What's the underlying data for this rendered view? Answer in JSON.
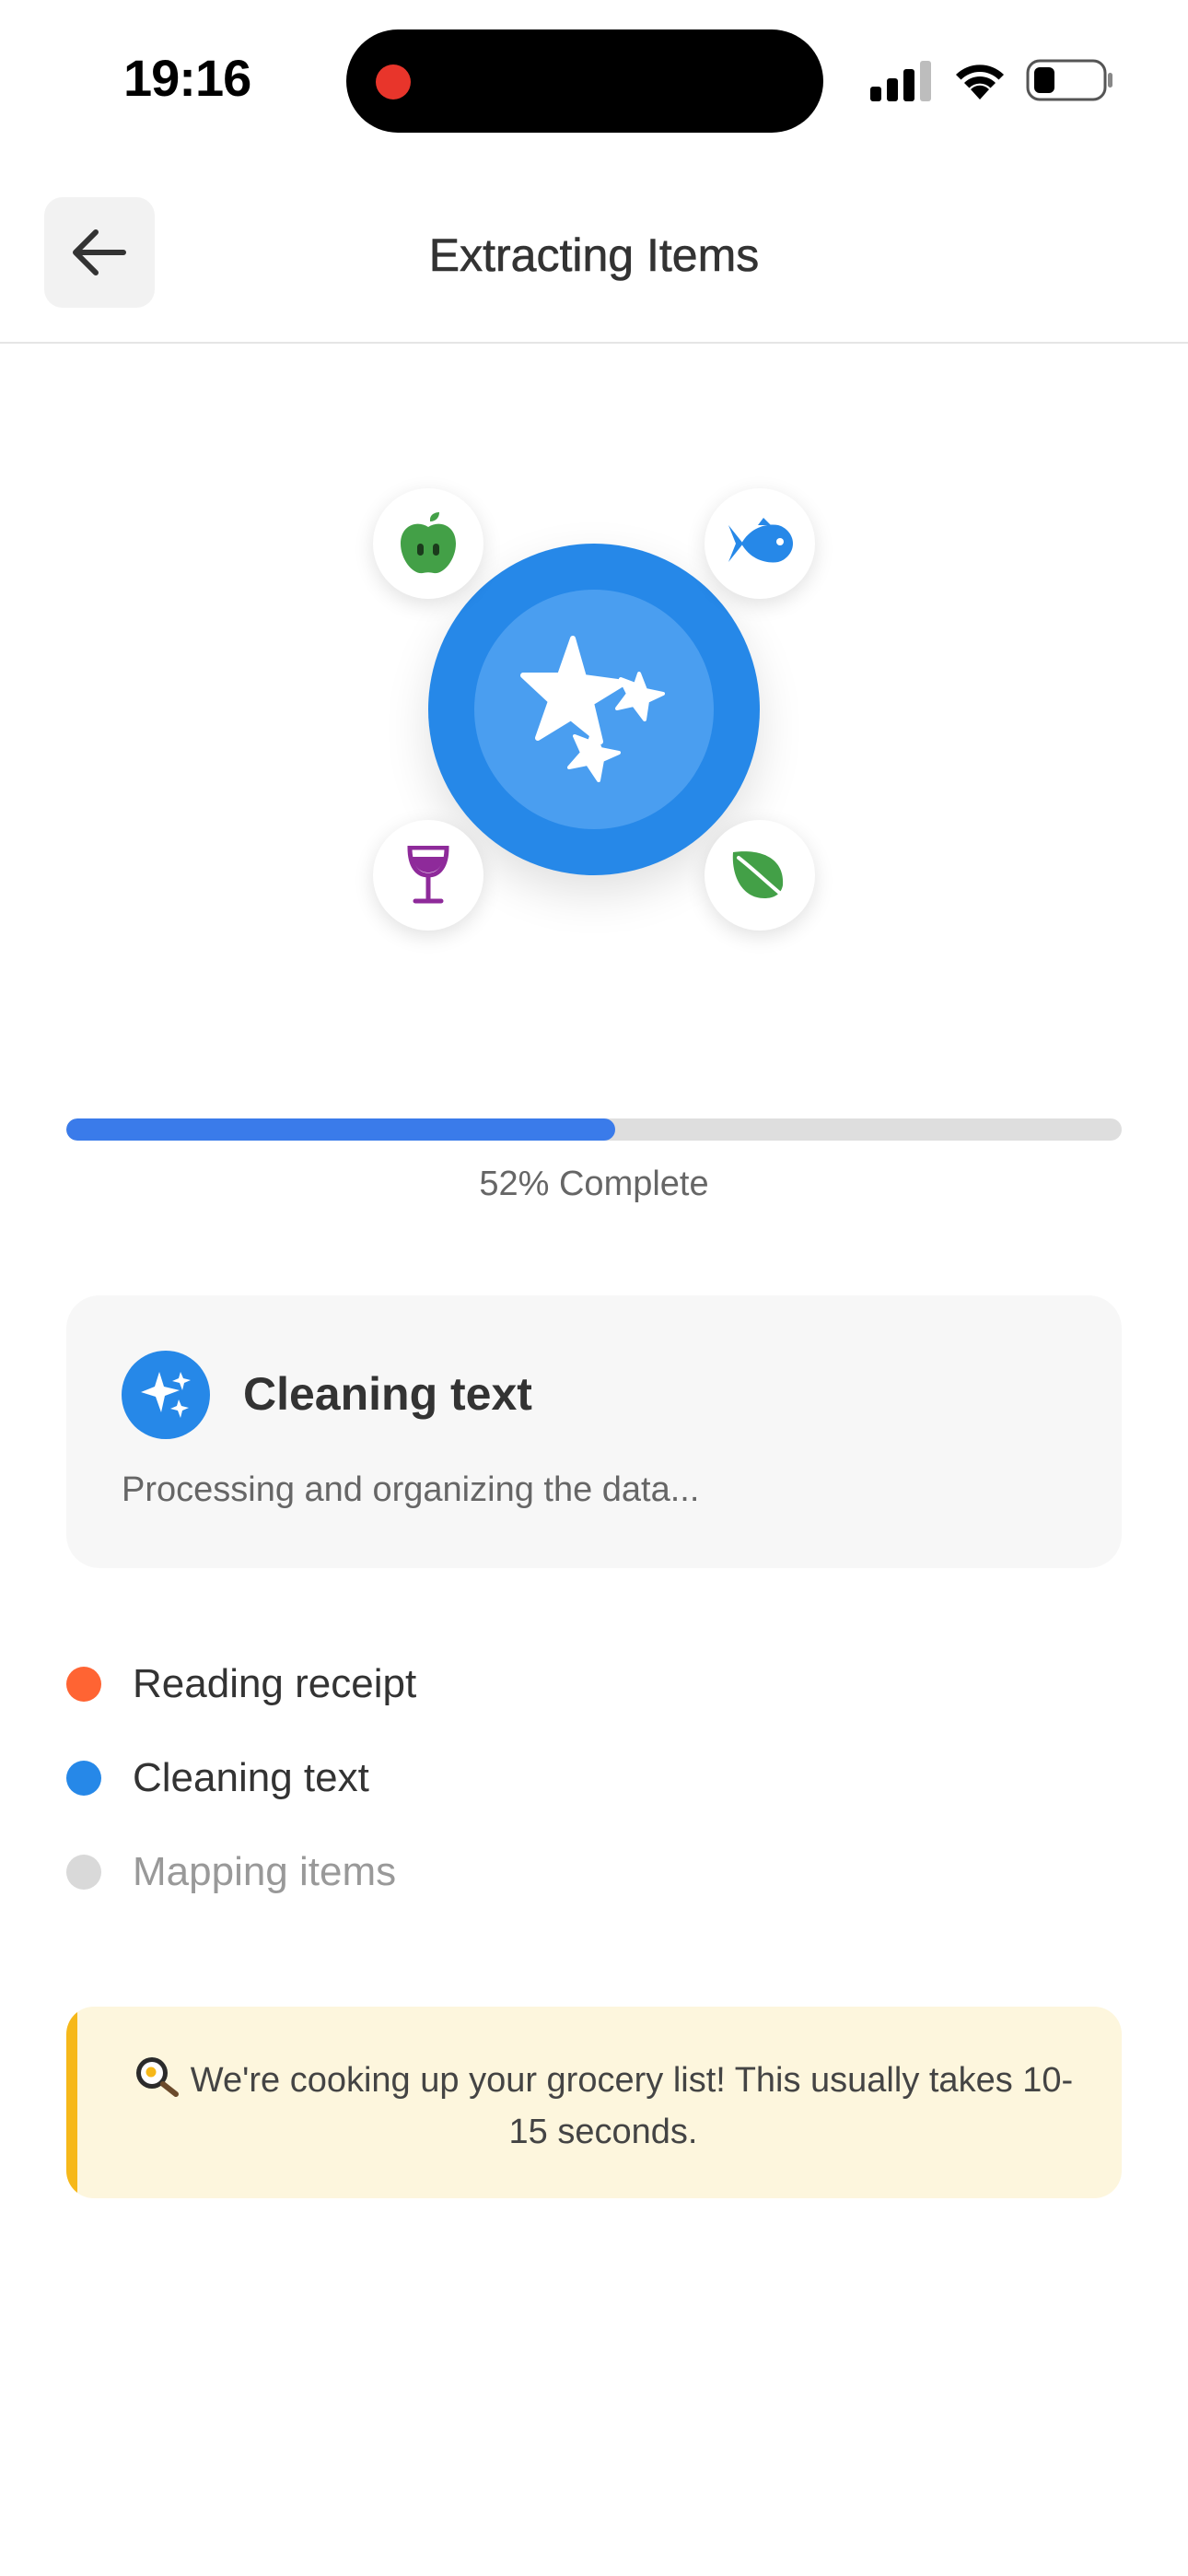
{
  "status_bar": {
    "time": "19:16",
    "icons": [
      "screen-recording-icon",
      "cellular-signal-icon",
      "wifi-icon",
      "battery-icon"
    ]
  },
  "header": {
    "title": "Extracting Items",
    "back_icon": "arrow-left-icon"
  },
  "hero": {
    "center_icon": "sparkles-icon",
    "food_icons": [
      "apple-icon",
      "fish-icon",
      "wine-glass-icon",
      "leaf-icon"
    ]
  },
  "progress": {
    "percent": 52,
    "label": "52% Complete"
  },
  "current_step": {
    "icon": "sparkles-icon",
    "title": "Cleaning text",
    "description": "Processing and organizing the data..."
  },
  "steps": [
    {
      "label": "Reading receipt",
      "status": "done"
    },
    {
      "label": "Cleaning text",
      "status": "active"
    },
    {
      "label": "Mapping items",
      "status": "pending"
    }
  ],
  "tip": {
    "icon": "frying-pan-egg-icon",
    "text": "We're cooking up your grocery list! This usually takes 10-15 seconds."
  },
  "colors": {
    "primary": "#2688e8",
    "progress_fill": "#3a7bea",
    "done": "#ff6433",
    "active": "#2688e8",
    "pending": "#d9d9d9",
    "tip_bg": "#fdf6dd",
    "tip_accent": "#f6b81a"
  }
}
